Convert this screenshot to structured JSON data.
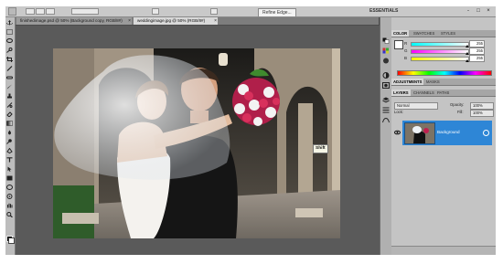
{
  "options_bar": {
    "refine_edge_label": "Refine Edge...",
    "workspace_label": "ESSENTIALS",
    "window_controls": [
      "-",
      "□",
      "×"
    ]
  },
  "tabs": [
    {
      "label": "finishedimage.psd @ 50% (Background copy, RGB/8#)",
      "close": "×"
    },
    {
      "label": "weddingimage.jpg @ 50% (RGB/8#)",
      "close": "×"
    }
  ],
  "canvas": {
    "tooltip": "Shift"
  },
  "color_panel": {
    "tabs": [
      "COLOR",
      "SWATCHES",
      "STYLES"
    ],
    "sliders": [
      {
        "label": "R",
        "value": "255",
        "color_from": "#00ffff",
        "color_to": "#ffffff",
        "level": 1.0
      },
      {
        "label": "G",
        "value": "255",
        "color_from": "#ff00ff",
        "color_to": "#ffffff",
        "level": 1.0
      },
      {
        "label": "B",
        "value": "255",
        "color_from": "#ffff00",
        "color_to": "#ffffff",
        "level": 1.0
      }
    ]
  },
  "adjustments_panel": {
    "tabs": [
      "ADJUSTMENTS",
      "MASKS"
    ]
  },
  "layers_panel": {
    "tabs": [
      "LAYERS",
      "CHANNELS",
      "PATHS"
    ],
    "blend_mode": "Normal",
    "opacity_label": "Opacity:",
    "opacity_value": "100%",
    "lock_label": "Lock:",
    "fill_label": "Fill:",
    "fill_value": "100%",
    "layers": [
      {
        "name": "Background",
        "selected": true,
        "visible": true
      }
    ]
  },
  "colors": {
    "app_bg": "#4b4b4b",
    "panel_bg": "#c4c4c4",
    "selection": "#2e86d6"
  },
  "icons": {
    "tools": [
      "move-tool-icon",
      "marquee-tool-icon",
      "lasso-tool-icon",
      "quick-selection-tool-icon",
      "crop-tool-icon",
      "eyedropper-tool-icon",
      "healing-brush-icon",
      "brush-tool-icon",
      "clone-stamp-icon",
      "history-brush-icon",
      "eraser-tool-icon",
      "gradient-tool-icon",
      "blur-tool-icon",
      "dodge-tool-icon",
      "pen-tool-icon",
      "type-tool-icon",
      "path-selection-icon",
      "shape-tool-icon",
      "3d-rotate-icon",
      "3d-orbit-icon",
      "hand-tool-icon",
      "zoom-tool-icon"
    ],
    "right_column": [
      "color-panel-icon",
      "swatches-icon",
      "styles-icon",
      "adjustments-icon",
      "masks-icon",
      "layers-icon",
      "channels-icon",
      "paths-icon"
    ]
  }
}
